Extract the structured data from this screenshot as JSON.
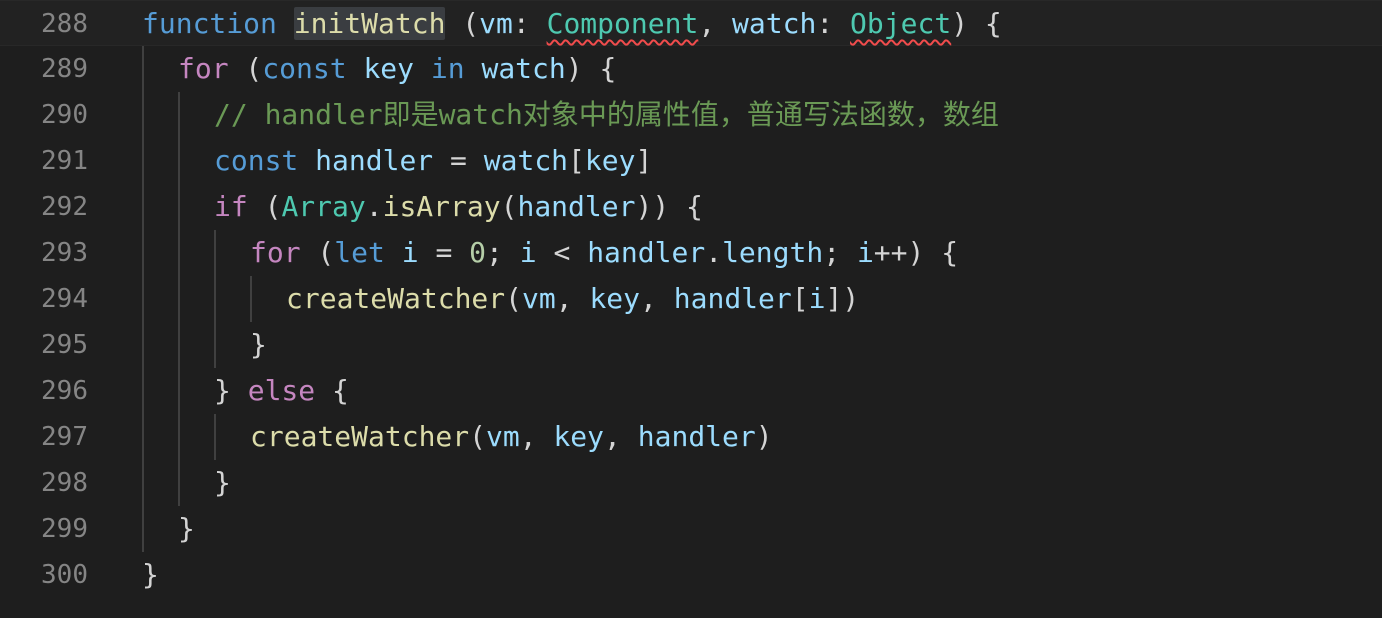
{
  "lines": [
    {
      "number": "288",
      "tokens": [
        {
          "t": "function",
          "c": "kw"
        },
        {
          "t": " ",
          "c": "pun"
        },
        {
          "t": "initWatch",
          "c": "fn",
          "h": true
        },
        {
          "t": " (",
          "c": "pun"
        },
        {
          "t": "vm",
          "c": "var"
        },
        {
          "t": ": ",
          "c": "pun"
        },
        {
          "t": "Component",
          "c": "typ",
          "s": true
        },
        {
          "t": ", ",
          "c": "pun"
        },
        {
          "t": "watch",
          "c": "var"
        },
        {
          "t": ": ",
          "c": "pun"
        },
        {
          "t": "Object",
          "c": "typ",
          "s": true
        },
        {
          "t": ") {",
          "c": "pun"
        }
      ]
    },
    {
      "number": "289",
      "tokens": [
        {
          "t": "for",
          "c": "ctl"
        },
        {
          "t": " (",
          "c": "pun"
        },
        {
          "t": "const",
          "c": "kw"
        },
        {
          "t": " ",
          "c": "pun"
        },
        {
          "t": "key",
          "c": "var"
        },
        {
          "t": " ",
          "c": "pun"
        },
        {
          "t": "in",
          "c": "kw"
        },
        {
          "t": " ",
          "c": "pun"
        },
        {
          "t": "watch",
          "c": "var"
        },
        {
          "t": ") {",
          "c": "pun"
        }
      ]
    },
    {
      "number": "290",
      "tokens": [
        {
          "t": "// handler即是watch对象中的属性值，普通写法函数，数组",
          "c": "cmt"
        }
      ]
    },
    {
      "number": "291",
      "tokens": [
        {
          "t": "const",
          "c": "kw"
        },
        {
          "t": " ",
          "c": "pun"
        },
        {
          "t": "handler",
          "c": "var"
        },
        {
          "t": " = ",
          "c": "pun"
        },
        {
          "t": "watch",
          "c": "var"
        },
        {
          "t": "[",
          "c": "pun"
        },
        {
          "t": "key",
          "c": "var"
        },
        {
          "t": "]",
          "c": "pun"
        }
      ]
    },
    {
      "number": "292",
      "tokens": [
        {
          "t": "if",
          "c": "ctl"
        },
        {
          "t": " (",
          "c": "pun"
        },
        {
          "t": "Array",
          "c": "typ"
        },
        {
          "t": ".",
          "c": "pun"
        },
        {
          "t": "isArray",
          "c": "fn"
        },
        {
          "t": "(",
          "c": "pun"
        },
        {
          "t": "handler",
          "c": "var"
        },
        {
          "t": ")) {",
          "c": "pun"
        }
      ]
    },
    {
      "number": "293",
      "tokens": [
        {
          "t": "for",
          "c": "ctl"
        },
        {
          "t": " (",
          "c": "pun"
        },
        {
          "t": "let",
          "c": "kw"
        },
        {
          "t": " ",
          "c": "pun"
        },
        {
          "t": "i",
          "c": "var"
        },
        {
          "t": " = ",
          "c": "pun"
        },
        {
          "t": "0",
          "c": "num"
        },
        {
          "t": "; ",
          "c": "pun"
        },
        {
          "t": "i",
          "c": "var"
        },
        {
          "t": " < ",
          "c": "pun"
        },
        {
          "t": "handler",
          "c": "var"
        },
        {
          "t": ".",
          "c": "pun"
        },
        {
          "t": "length",
          "c": "var"
        },
        {
          "t": "; ",
          "c": "pun"
        },
        {
          "t": "i",
          "c": "var"
        },
        {
          "t": "++) {",
          "c": "pun"
        }
      ]
    },
    {
      "number": "294",
      "tokens": [
        {
          "t": "createWatcher",
          "c": "fn"
        },
        {
          "t": "(",
          "c": "pun"
        },
        {
          "t": "vm",
          "c": "var"
        },
        {
          "t": ", ",
          "c": "pun"
        },
        {
          "t": "key",
          "c": "var"
        },
        {
          "t": ", ",
          "c": "pun"
        },
        {
          "t": "handler",
          "c": "var"
        },
        {
          "t": "[",
          "c": "pun"
        },
        {
          "t": "i",
          "c": "var"
        },
        {
          "t": "])",
          "c": "pun"
        }
      ]
    },
    {
      "number": "295",
      "tokens": [
        {
          "t": "}",
          "c": "pun"
        }
      ]
    },
    {
      "number": "296",
      "tokens": [
        {
          "t": "} ",
          "c": "pun"
        },
        {
          "t": "else",
          "c": "ctl"
        },
        {
          "t": " {",
          "c": "pun"
        }
      ]
    },
    {
      "number": "297",
      "tokens": [
        {
          "t": "createWatcher",
          "c": "fn"
        },
        {
          "t": "(",
          "c": "pun"
        },
        {
          "t": "vm",
          "c": "var"
        },
        {
          "t": ", ",
          "c": "pun"
        },
        {
          "t": "key",
          "c": "var"
        },
        {
          "t": ", ",
          "c": "pun"
        },
        {
          "t": "handler",
          "c": "var"
        },
        {
          "t": ")",
          "c": "pun"
        }
      ]
    },
    {
      "number": "298",
      "tokens": [
        {
          "t": "}",
          "c": "pun"
        }
      ]
    },
    {
      "number": "299",
      "tokens": [
        {
          "t": "}",
          "c": "pun"
        }
      ]
    },
    {
      "number": "300",
      "tokens": [
        {
          "t": "}",
          "c": "pun"
        }
      ]
    }
  ]
}
